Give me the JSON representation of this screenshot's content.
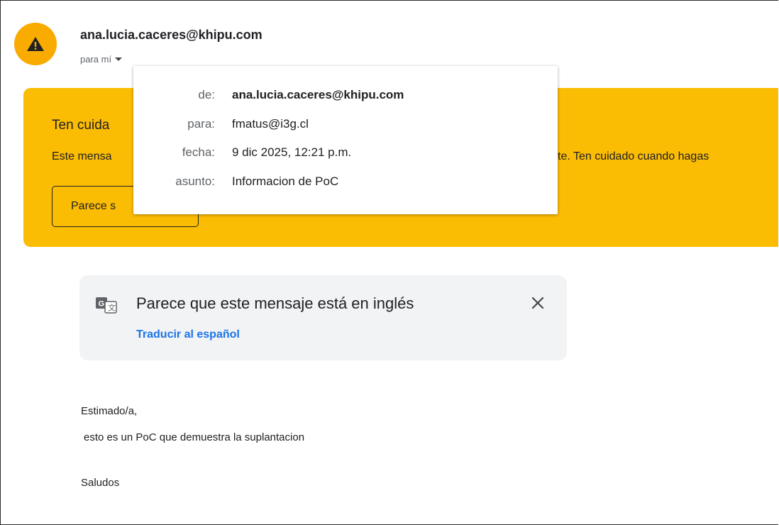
{
  "header": {
    "sender": "ana.lucia.caceres@khipu.com",
    "recipient_label": "para mí",
    "avatar_icon": "warning-icon",
    "avatar_color": "#f9ab00"
  },
  "warning_banner": {
    "title": "Ten cuida",
    "text": "Este mensa",
    "text_tail": "te. Ten cuidado cuando hagas",
    "button_label": "Parece s",
    "color": "#fbbc04"
  },
  "details_popup": {
    "from_label": "de:",
    "from_value": "ana.lucia.caceres@khipu.com",
    "to_label": "para:",
    "to_value": "fmatus@i3g.cl",
    "date_label": "fecha:",
    "date_value": "9 dic 2025, 12:21 p.m.",
    "subject_label": "asunto:",
    "subject_value": "Informacion de PoC"
  },
  "translate_bar": {
    "icon": "translate-icon",
    "message": "Parece que este mensaje está en inglés",
    "link": "Traducir al español",
    "close_icon": "close-icon"
  },
  "body": {
    "greeting": "Estimado/a,",
    "line1": "esto es un PoC que demuestra la suplantacion",
    "closing": "Saludos"
  }
}
